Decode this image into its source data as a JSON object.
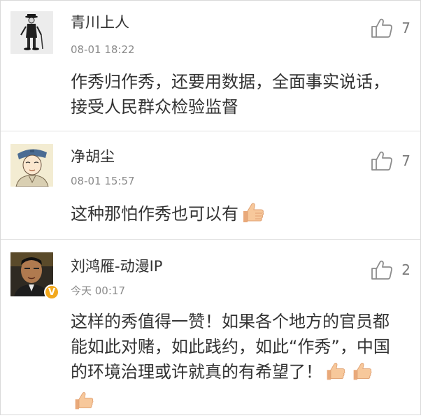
{
  "comments": [
    {
      "username": "青川上人",
      "time": "08-01 18:22",
      "text": "作秀归作秀，还要用数据，全面事实说话，接受人民群众检验监督",
      "likes": "7",
      "avatar": "charlie-chaplin-avatar"
    },
    {
      "username": "净胡尘",
      "time": "08-01 15:57",
      "text": "这种那怕作秀也可以有",
      "likes": "7",
      "avatar": "cartoon-scholar-avatar"
    },
    {
      "username": "刘鸿雁-动漫IP",
      "time": "今天 00:17",
      "text": "这样的秀值得一赞！如果各个地方的官员都能如此对赌，如此践约，如此“作秀”，中国的环境治理或许就真的有希望了！",
      "likes": "2",
      "avatar": "man-portrait-avatar",
      "badge": "V"
    }
  ],
  "colors": {
    "text": "#333333",
    "muted": "#8a8a8a",
    "divider": "#e3e3e3",
    "badge": "#f2a81d",
    "thumb_emoji": "#f6c493"
  },
  "icons": {
    "like": "thumbs-up-outline-icon",
    "emoji": "thumbs-up-emoji-icon"
  }
}
